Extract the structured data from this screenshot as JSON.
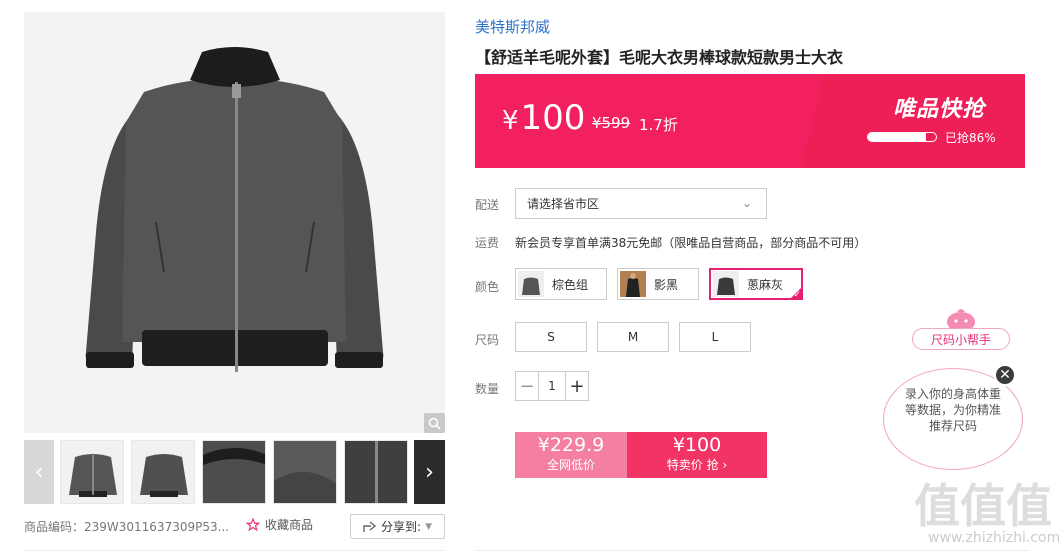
{
  "product": {
    "brand": "美特斯邦威",
    "title": "【舒适羊毛呢外套】毛呢大衣男棒球款短款男士大衣",
    "sku_text": "商品编码：239W3011637309P53...",
    "favorite_label": "收藏商品",
    "share_label": "分享到:"
  },
  "price_banner": {
    "price": "100",
    "currency": "¥",
    "original_price": "¥599",
    "discount": "1.7折",
    "flash_title": "唯品快抢",
    "sold_text": "已抢86%",
    "sold_fraction": 0.86
  },
  "delivery": {
    "label": "配送",
    "placeholder": "请选择省市区"
  },
  "shipping": {
    "label": "运费",
    "text": "新会员专享首单满38元免邮（限唯品自营商品，部分商品不可用）"
  },
  "colors": {
    "label": "颜色",
    "options": [
      "棕色组",
      "影黑",
      "蔥麻灰"
    ],
    "selected_index": 2
  },
  "sizes": {
    "label": "尺码",
    "options": [
      "S",
      "M",
      "L"
    ]
  },
  "quantity": {
    "label": "数量",
    "value": "1",
    "minus": "−",
    "plus": "+"
  },
  "buttons": {
    "market_price": "¥229.9",
    "market_label": "全网低价",
    "special_price": "¥100",
    "special_label": "特卖价 抢 ›"
  },
  "helper": {
    "tag": "尺码小帮手",
    "text": "录入你的身高体重等数据，为你精准推荐尺码"
  },
  "watermark": {
    "text": "值值值",
    "url": "www.zhizhizhi.com"
  },
  "colors_theme": {
    "accent": "#f3205f",
    "brand_link": "#2f73c9",
    "select_border": "#e61e74"
  }
}
